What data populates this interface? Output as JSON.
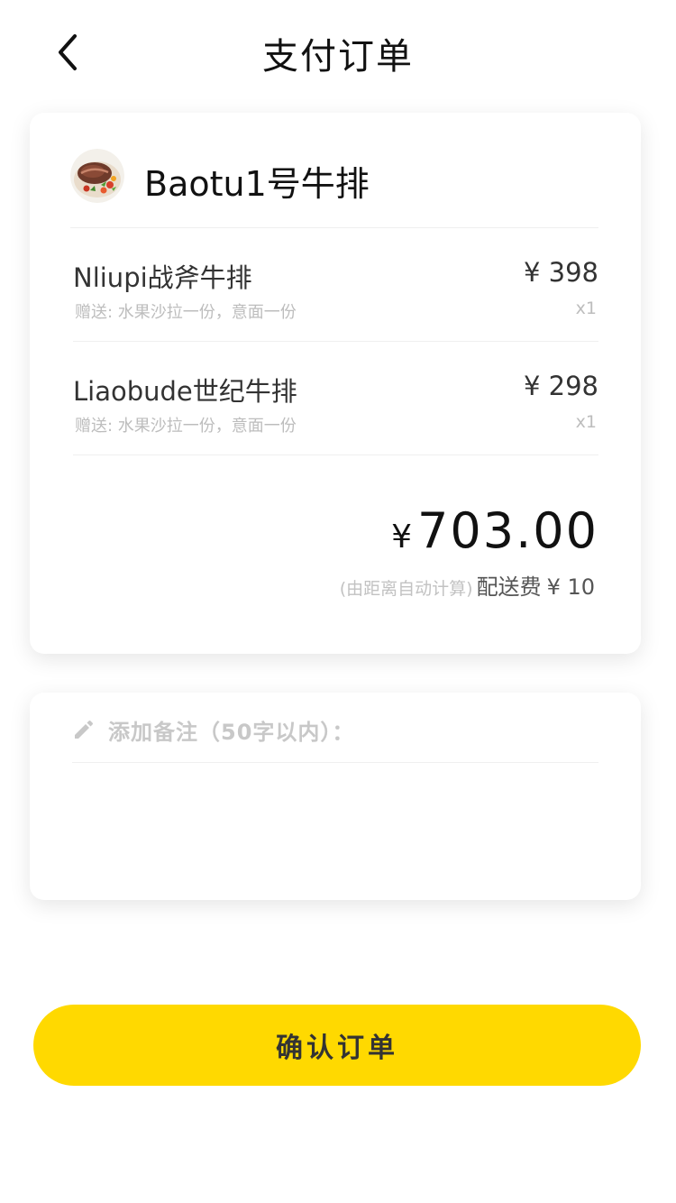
{
  "header": {
    "title": "支付订单",
    "back_icon": "chevron-left-icon"
  },
  "shop": {
    "name": "Baotu1号牛排",
    "avatar": "steak-dish-image"
  },
  "items": [
    {
      "name": "Nliupi战斧牛排",
      "gift": "赠送: 水果沙拉一份，意面一份",
      "price": "¥ 398",
      "qty": "x1"
    },
    {
      "name": "Liaobude世纪牛排",
      "gift": "赠送: 水果沙拉一份，意面一份",
      "price": "¥ 298",
      "qty": "x1"
    }
  ],
  "total": {
    "currency": "¥",
    "amount": "703.00"
  },
  "delivery": {
    "note": "(由距离自动计算)",
    "label": "配送费",
    "fee": "¥ 10"
  },
  "remark": {
    "icon": "pencil-icon",
    "label": "添加备注（50字以内）：",
    "value": ""
  },
  "confirm": {
    "label": "确认订单"
  },
  "colors": {
    "accent": "#FFD900",
    "muted": "#BDBDBD"
  }
}
